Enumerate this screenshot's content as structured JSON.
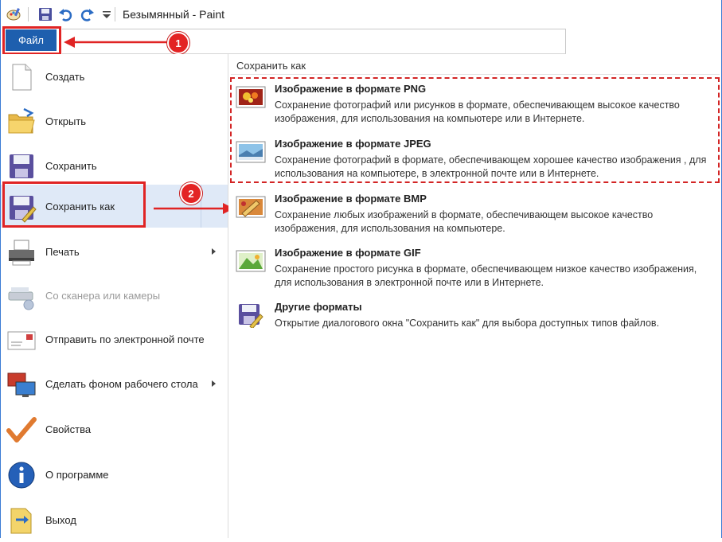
{
  "window": {
    "title": "Безымянный - Paint"
  },
  "quick_access": [
    "paint-app-icon",
    "save-icon",
    "undo-icon",
    "redo-icon",
    "customize-dropdown-icon"
  ],
  "ribbon": {
    "file_tab": "Файл"
  },
  "file_menu": {
    "items": [
      {
        "label": "Создать",
        "icon": "new-document-icon"
      },
      {
        "label": "Открыть",
        "icon": "open-folder-icon"
      },
      {
        "label": "Сохранить",
        "icon": "save-disk-icon"
      },
      {
        "label": "Сохранить как",
        "icon": "save-as-icon"
      },
      {
        "label": "Печать",
        "icon": "printer-icon"
      },
      {
        "label": "Со сканера или камеры",
        "icon": "scanner-icon"
      },
      {
        "label": "Отправить по электронной почте",
        "icon": "email-icon"
      },
      {
        "label": "Сделать фоном рабочего стола",
        "icon": "desktop-background-icon"
      },
      {
        "label": "Свойства",
        "icon": "checkmark-icon"
      },
      {
        "label": "О программе",
        "icon": "info-icon"
      },
      {
        "label": "Выход",
        "icon": "exit-icon"
      }
    ]
  },
  "save_as_panel": {
    "header": "Сохранить как",
    "options": [
      {
        "title": "Изображение в формате PNG",
        "description": "Сохранение фотографий или рисунков в формате, обеспечивающем высокое качество изображения, для использования на компьютере или в Интернете."
      },
      {
        "title": "Изображение в формате JPEG",
        "description": "Сохранение фотографий в формате, обеспечивающем хорошее качество изображения , для использования на компьютере, в электронной почте или в Интернете."
      },
      {
        "title": "Изображение в формате BMP",
        "description": "Сохранение любых изображений в формате, обеспечивающем высокое качество изображения, для использования на компьютере."
      },
      {
        "title": "Изображение в формате GIF",
        "description": "Сохранение простого рисунка в формате, обеспечивающем низкое качество изображения, для использования в электронной почте или в Интернете."
      },
      {
        "title": "Другие форматы",
        "description": "Открытие диалогового окна \"Сохранить как\" для выбора доступных типов файлов."
      }
    ]
  },
  "annotations": {
    "badge_1": "1",
    "badge_2": "2"
  },
  "colors": {
    "accent": "#1e5fae",
    "annotation_red": "#e02424",
    "highlight": "#dfe9f7"
  }
}
